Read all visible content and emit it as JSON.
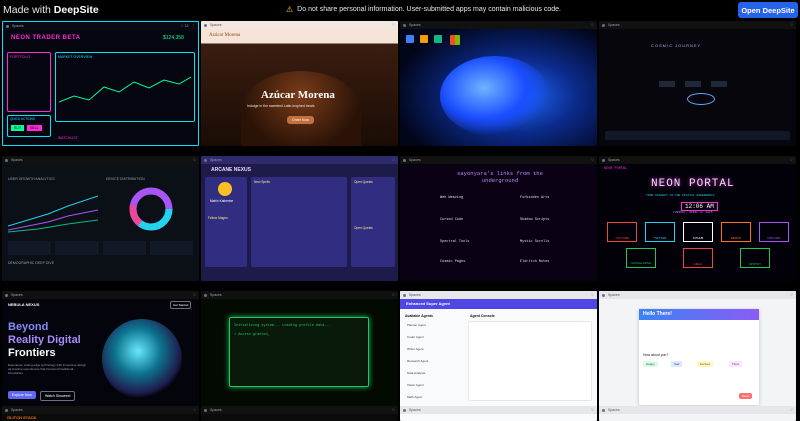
{
  "header": {
    "made_with": "Made with",
    "brand": "DeepSite",
    "notice": "Do not share personal information. User-submitted apps may contain malicious code.",
    "open_button": "Open DeepSite"
  },
  "cards": {
    "neon_trader": {
      "title": "NEON TRADER BETA",
      "value": "$124,358",
      "sub1": "PORTFOLIO",
      "sub2": "MARKET OVERVIEW",
      "sub3": "QUICK ACTIONS",
      "buy": "BUY",
      "sell": "SELL",
      "watchlist": "WATCHLIST"
    },
    "azucar": {
      "nav_brand": "Azúcar Morena",
      "hero": "Azúcar Morena",
      "tagline": "Indulge in the sweetest Latin-inspired treats",
      "cta": "Order Now"
    },
    "cosmic": {
      "title": "COSMIC JOURNEY"
    },
    "dashboard": {
      "title": "USER GROWTH ANALYTICS",
      "t2": "DEVICE DISTRIBUTION",
      "t3": "DEMOGRAPHIC DEEP DIVE"
    },
    "social": {
      "brand": "ARCANE NEXUS",
      "name": "Marlin Katherine",
      "t1": "Open Quests",
      "t2": "Fellow Mages",
      "t3": "New Spells",
      "t4": "Open Quests"
    },
    "links": {
      "title": "sayonyara's links from the underground",
      "l1": "Web Weaving",
      "l2": "Forbidden Arts",
      "l3": "Cursed Code",
      "l4": "Shadow Scripts",
      "l5": "Spectral Tools",
      "l6": "Mystic Scrolls",
      "l7": "Cosmic Pages",
      "l8": "Eldritch Notes"
    },
    "neon_portal": {
      "brand": "NEON PORTAL",
      "title": "NEON PORTAL",
      "sub": "YOUR GATEWAY TO THE DIGITAL UNDERWORLD",
      "clock": "12:06 AM",
      "date": "TUESDAY, APRIL 8, 2025",
      "b1": "YOUTUBE",
      "b2": "TWITTER",
      "b3": "GITHUB",
      "b4": "REDDIT",
      "b5": "DISCORD",
      "b6": "GOOGLE DRIVE",
      "b7": "GMAIL",
      "b8": "SPOTIFY"
    },
    "beyond": {
      "logo": "NEBULA NEXUS",
      "h1": "Beyond",
      "h2": "Reality Digital",
      "h3": "Frontiers",
      "body": "Experience cutting-edge technology with immersive design as creative experiences that transcend traditional boundaries.",
      "cta1": "Explore Now",
      "cta2": "Watch Showreel",
      "nav_cta": "Get Started"
    },
    "terminal": {
      "line1": "Initializing system... Loading profile data...",
      "line2": "> Access granted_"
    },
    "agent": {
      "title": "Enhanced Super Agent",
      "sidebar_title": "Available Agents",
      "a1": "Planner Agent",
      "a2": "Coder Agent",
      "a3": "Writer Agent",
      "a4": "Research Agent",
      "a5": "Data Analysis",
      "a6": "Vision Agent",
      "a7": "Math Agent",
      "chat_title": "Agent Console",
      "status": "Agent Status"
    },
    "chat": {
      "title": "Hello There!",
      "q": "How about you?",
      "b1": "Happy",
      "b2": "Sad",
      "b3": "Excited",
      "b4": "Tired",
      "send": "Send"
    },
    "retro": {
      "brand": "GLITCH STACK"
    }
  }
}
